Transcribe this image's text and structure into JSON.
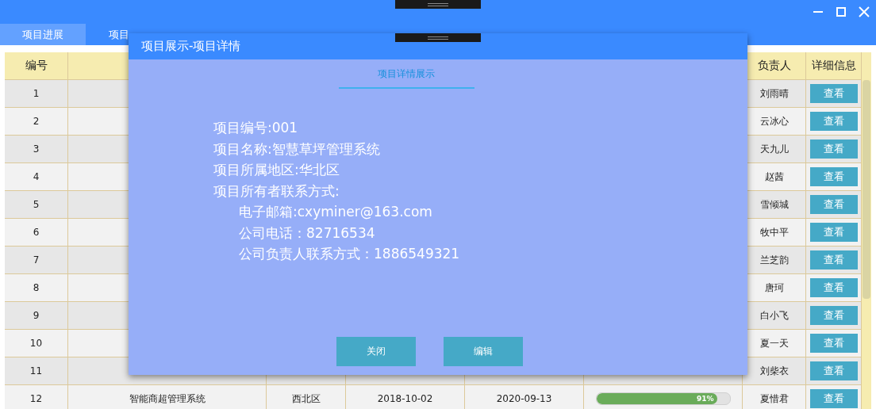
{
  "tabs": [
    {
      "label": "项目进展",
      "selected": true
    },
    {
      "label": "项目",
      "selected": false
    }
  ],
  "table": {
    "header": {
      "number": "编号",
      "leader": "负责人",
      "detail": "详细信息"
    },
    "rows": [
      {
        "number": "1",
        "leader": "刘雨晴",
        "button": "查看"
      },
      {
        "number": "2",
        "leader": "云冰心",
        "button": "查看"
      },
      {
        "number": "3",
        "leader": "天九儿",
        "button": "查看"
      },
      {
        "number": "4",
        "leader": "赵茜",
        "button": "查看"
      },
      {
        "number": "5",
        "leader": "雪倾城",
        "button": "查看"
      },
      {
        "number": "6",
        "leader": "牧中平",
        "button": "查看"
      },
      {
        "number": "7",
        "leader": "兰芝韵",
        "button": "查看"
      },
      {
        "number": "8",
        "leader": "唐珂",
        "button": "查看"
      },
      {
        "number": "9",
        "leader": "白小飞",
        "button": "查看"
      },
      {
        "number": "10",
        "leader": "夏一天",
        "button": "查看"
      },
      {
        "number": "11",
        "leader": "刘柴衣",
        "button": "查看"
      },
      {
        "number": "12",
        "name": "智能商超管理系统",
        "region": "西北区",
        "column_4": "2018-10-02",
        "column_5": "2020-09-13",
        "progress": {
          "level": 0.91,
          "reading": "91%"
        },
        "leader": "夏惜君",
        "button": "查看"
      }
    ]
  },
  "dialog": {
    "title": "项目展示-项目详情",
    "tab": "项目详情展示",
    "lines": [
      {
        "text": "项目编号:001"
      },
      {
        "text": "项目名称:智慧草坪管理系统"
      },
      {
        "text": "项目所属地区:华北区"
      },
      {
        "text": "项目所有者联系方式:",
        "children": [
          {
            "text": "电子邮箱:cxyminer@163.com"
          },
          {
            "text": "公司电话：82716534"
          },
          {
            "text": "公司负责人联系方式：1886549321"
          }
        ]
      }
    ],
    "buttons": [
      "关闭",
      "编辑"
    ]
  }
}
